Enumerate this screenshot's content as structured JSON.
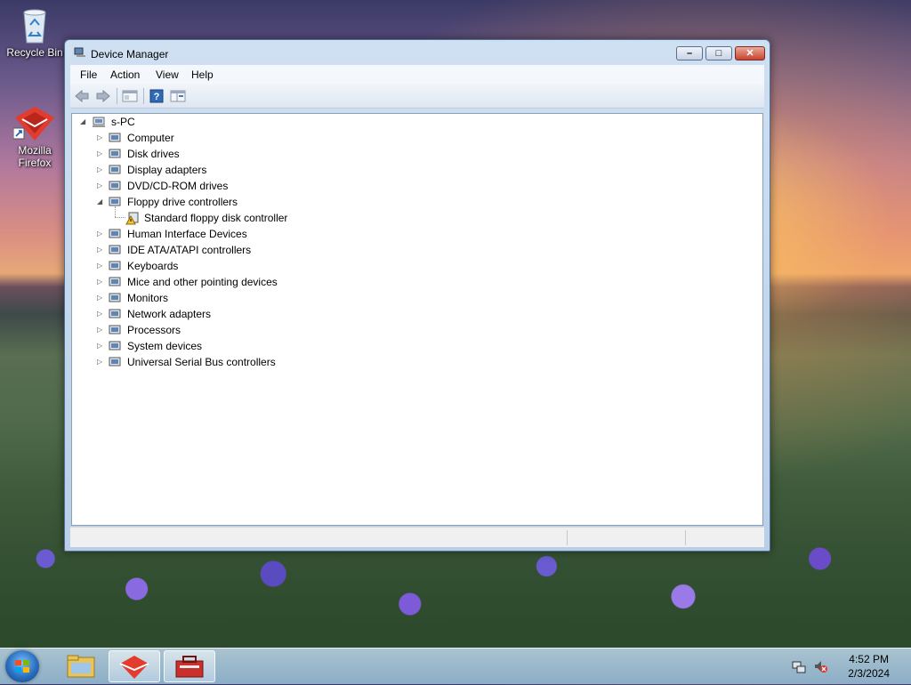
{
  "desktop": {
    "icons": [
      {
        "label": "Recycle Bin",
        "icon": "recycle-bin-icon"
      },
      {
        "label": "Mozilla Firefox",
        "icon": "firefox-icon"
      }
    ]
  },
  "window": {
    "title": "Device Manager",
    "controls": {
      "minimize": "–",
      "maximize": "□",
      "close": "✕"
    }
  },
  "menubar": [
    "File",
    "Action",
    "View",
    "Help"
  ],
  "toolbar": [
    "back-icon",
    "forward-icon",
    "properties-icon",
    "help-icon",
    "view-icon"
  ],
  "tree": {
    "root": "s-PC",
    "items": [
      {
        "label": "Computer",
        "icon": "computer-icon",
        "expanded": false
      },
      {
        "label": "Disk drives",
        "icon": "disk-drive-icon",
        "expanded": false
      },
      {
        "label": "Display adapters",
        "icon": "display-adapter-icon",
        "expanded": false
      },
      {
        "label": "DVD/CD-ROM drives",
        "icon": "dvd-drive-icon",
        "expanded": false
      },
      {
        "label": "Floppy drive controllers",
        "icon": "floppy-controller-icon",
        "expanded": true,
        "children": [
          {
            "label": "Standard floppy disk controller",
            "icon": "floppy-warning-icon"
          }
        ]
      },
      {
        "label": "Human Interface Devices",
        "icon": "hid-icon",
        "expanded": false
      },
      {
        "label": "IDE ATA/ATAPI controllers",
        "icon": "ide-controller-icon",
        "expanded": false
      },
      {
        "label": "Keyboards",
        "icon": "keyboard-icon",
        "expanded": false
      },
      {
        "label": "Mice and other pointing devices",
        "icon": "mouse-icon",
        "expanded": false
      },
      {
        "label": "Monitors",
        "icon": "monitor-icon",
        "expanded": false
      },
      {
        "label": "Network adapters",
        "icon": "network-adapter-icon",
        "expanded": false
      },
      {
        "label": "Processors",
        "icon": "processor-icon",
        "expanded": false
      },
      {
        "label": "System devices",
        "icon": "system-device-icon",
        "expanded": false
      },
      {
        "label": "Universal Serial Bus controllers",
        "icon": "usb-icon",
        "expanded": false
      }
    ]
  },
  "taskbar": {
    "buttons": [
      "file-explorer-icon",
      "firefox-icon",
      "device-manager-icon"
    ],
    "tray": [
      "network-icon",
      "volume-muted-icon"
    ],
    "time": "4:52 PM",
    "date": "2/3/2024"
  }
}
